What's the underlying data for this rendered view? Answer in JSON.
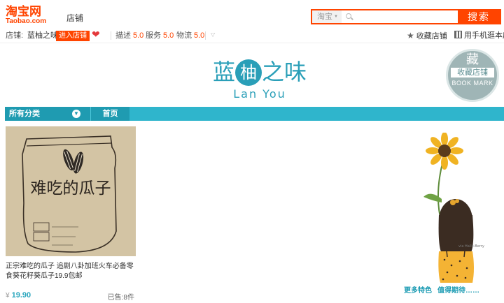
{
  "header": {
    "logo_cn": "淘宝网",
    "logo_en": "Taobao.com",
    "section_label": "店铺",
    "search_scope": "淘宝",
    "search_button": "搜索"
  },
  "shop_info": {
    "label": "店铺:",
    "shop_name": "蓝柚之味",
    "enter_button": "进入店铺",
    "ratings": [
      {
        "label": "描述",
        "score": "5.0"
      },
      {
        "label": "服务",
        "score": "5.0"
      },
      {
        "label": "物流",
        "score": "5.0"
      }
    ],
    "favorite_label": "收藏店铺",
    "mobile_label": "用手机逛本店"
  },
  "banner": {
    "brand_cn_1": "蓝",
    "brand_cn_2": "柚",
    "brand_cn_3": "之味",
    "brand_en": "Lan You",
    "bookmark_char": "藏",
    "bookmark_cn": "收藏店铺",
    "bookmark_en": "BOOK MARK"
  },
  "nav": {
    "all_categories": "所有分类",
    "home": "首页"
  },
  "product": {
    "image_caption": "难吃的瓜子",
    "title": "正宗难吃的瓜子 追剧八卦加班火车必备零食葵花籽葵瓜子19.9包邮",
    "currency": "¥",
    "price": "19.90",
    "sold": "已售:8件"
  },
  "decoration": {
    "watermark": "via Halle-Berry",
    "link1": "更多特色",
    "link2": "值得期待……"
  },
  "colors": {
    "taobao_orange": "#ff4400",
    "shop_teal": "#2fb5cc",
    "teal_dark": "#1f9bb1",
    "bookmark_grey": "#9fb5b6"
  }
}
